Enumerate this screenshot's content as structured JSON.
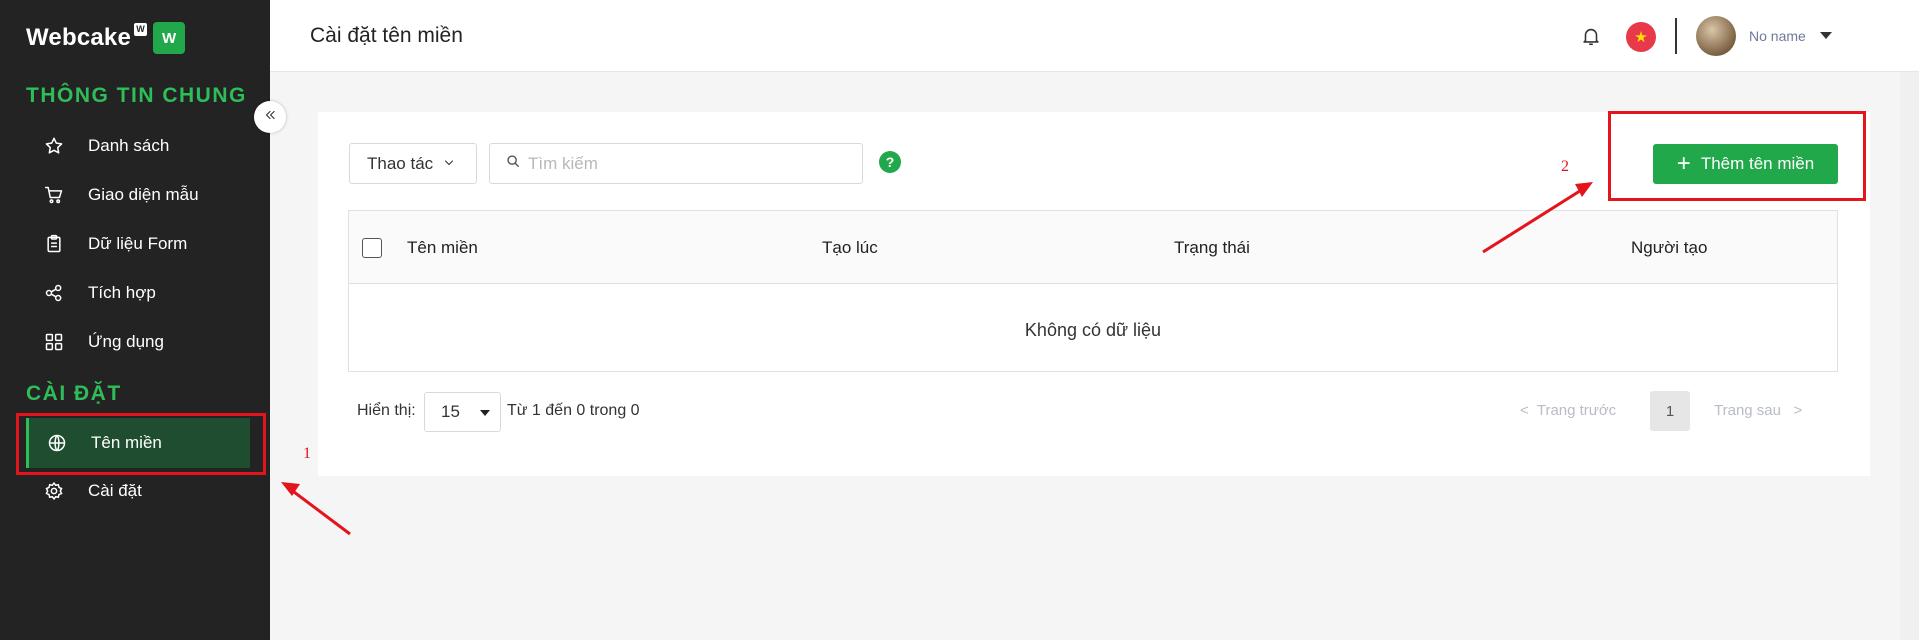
{
  "sidebar": {
    "logo_text": "Webcake",
    "logo_sup": "W",
    "logo_badge": "W",
    "sections": [
      "THÔNG TIN CHUNG",
      "CÀI ĐẶT"
    ],
    "items": [
      {
        "label": "Danh sách",
        "icon": "star-icon"
      },
      {
        "label": "Giao diện mẫu",
        "icon": "cart-icon"
      },
      {
        "label": "Dữ liệu Form",
        "icon": "clipboard-icon"
      },
      {
        "label": "Tích hợp",
        "icon": "share-icon"
      },
      {
        "label": "Ứng dụng",
        "icon": "grid-icon"
      },
      {
        "label": "Tên miền",
        "icon": "globe-icon",
        "active": true
      },
      {
        "label": "Cài đặt",
        "icon": "gear-icon"
      }
    ]
  },
  "header": {
    "title": "Cài đặt tên miền",
    "user_name": "No name"
  },
  "toolbar": {
    "action_label": "Thao tác",
    "search_placeholder": "Tìm kiếm",
    "help_label": "?",
    "add_label": "Thêm tên miền"
  },
  "table": {
    "columns": [
      "Tên miền",
      "Tạo lúc",
      "Trạng thái",
      "Người tạo"
    ],
    "empty_text": "Không có dữ liệu"
  },
  "pagination": {
    "show_label": "Hiển thị:",
    "page_size": "15",
    "range_text": "Từ 1 đến 0 trong 0",
    "prev_label": "Trang trước",
    "current_page": "1",
    "next_label": "Trang sau"
  },
  "annotations": {
    "label_1": "1",
    "label_2": "2"
  },
  "colors": {
    "brand_green": "#20a84a",
    "sidebar_bg": "#232323",
    "annotation_red": "#e3141b"
  }
}
